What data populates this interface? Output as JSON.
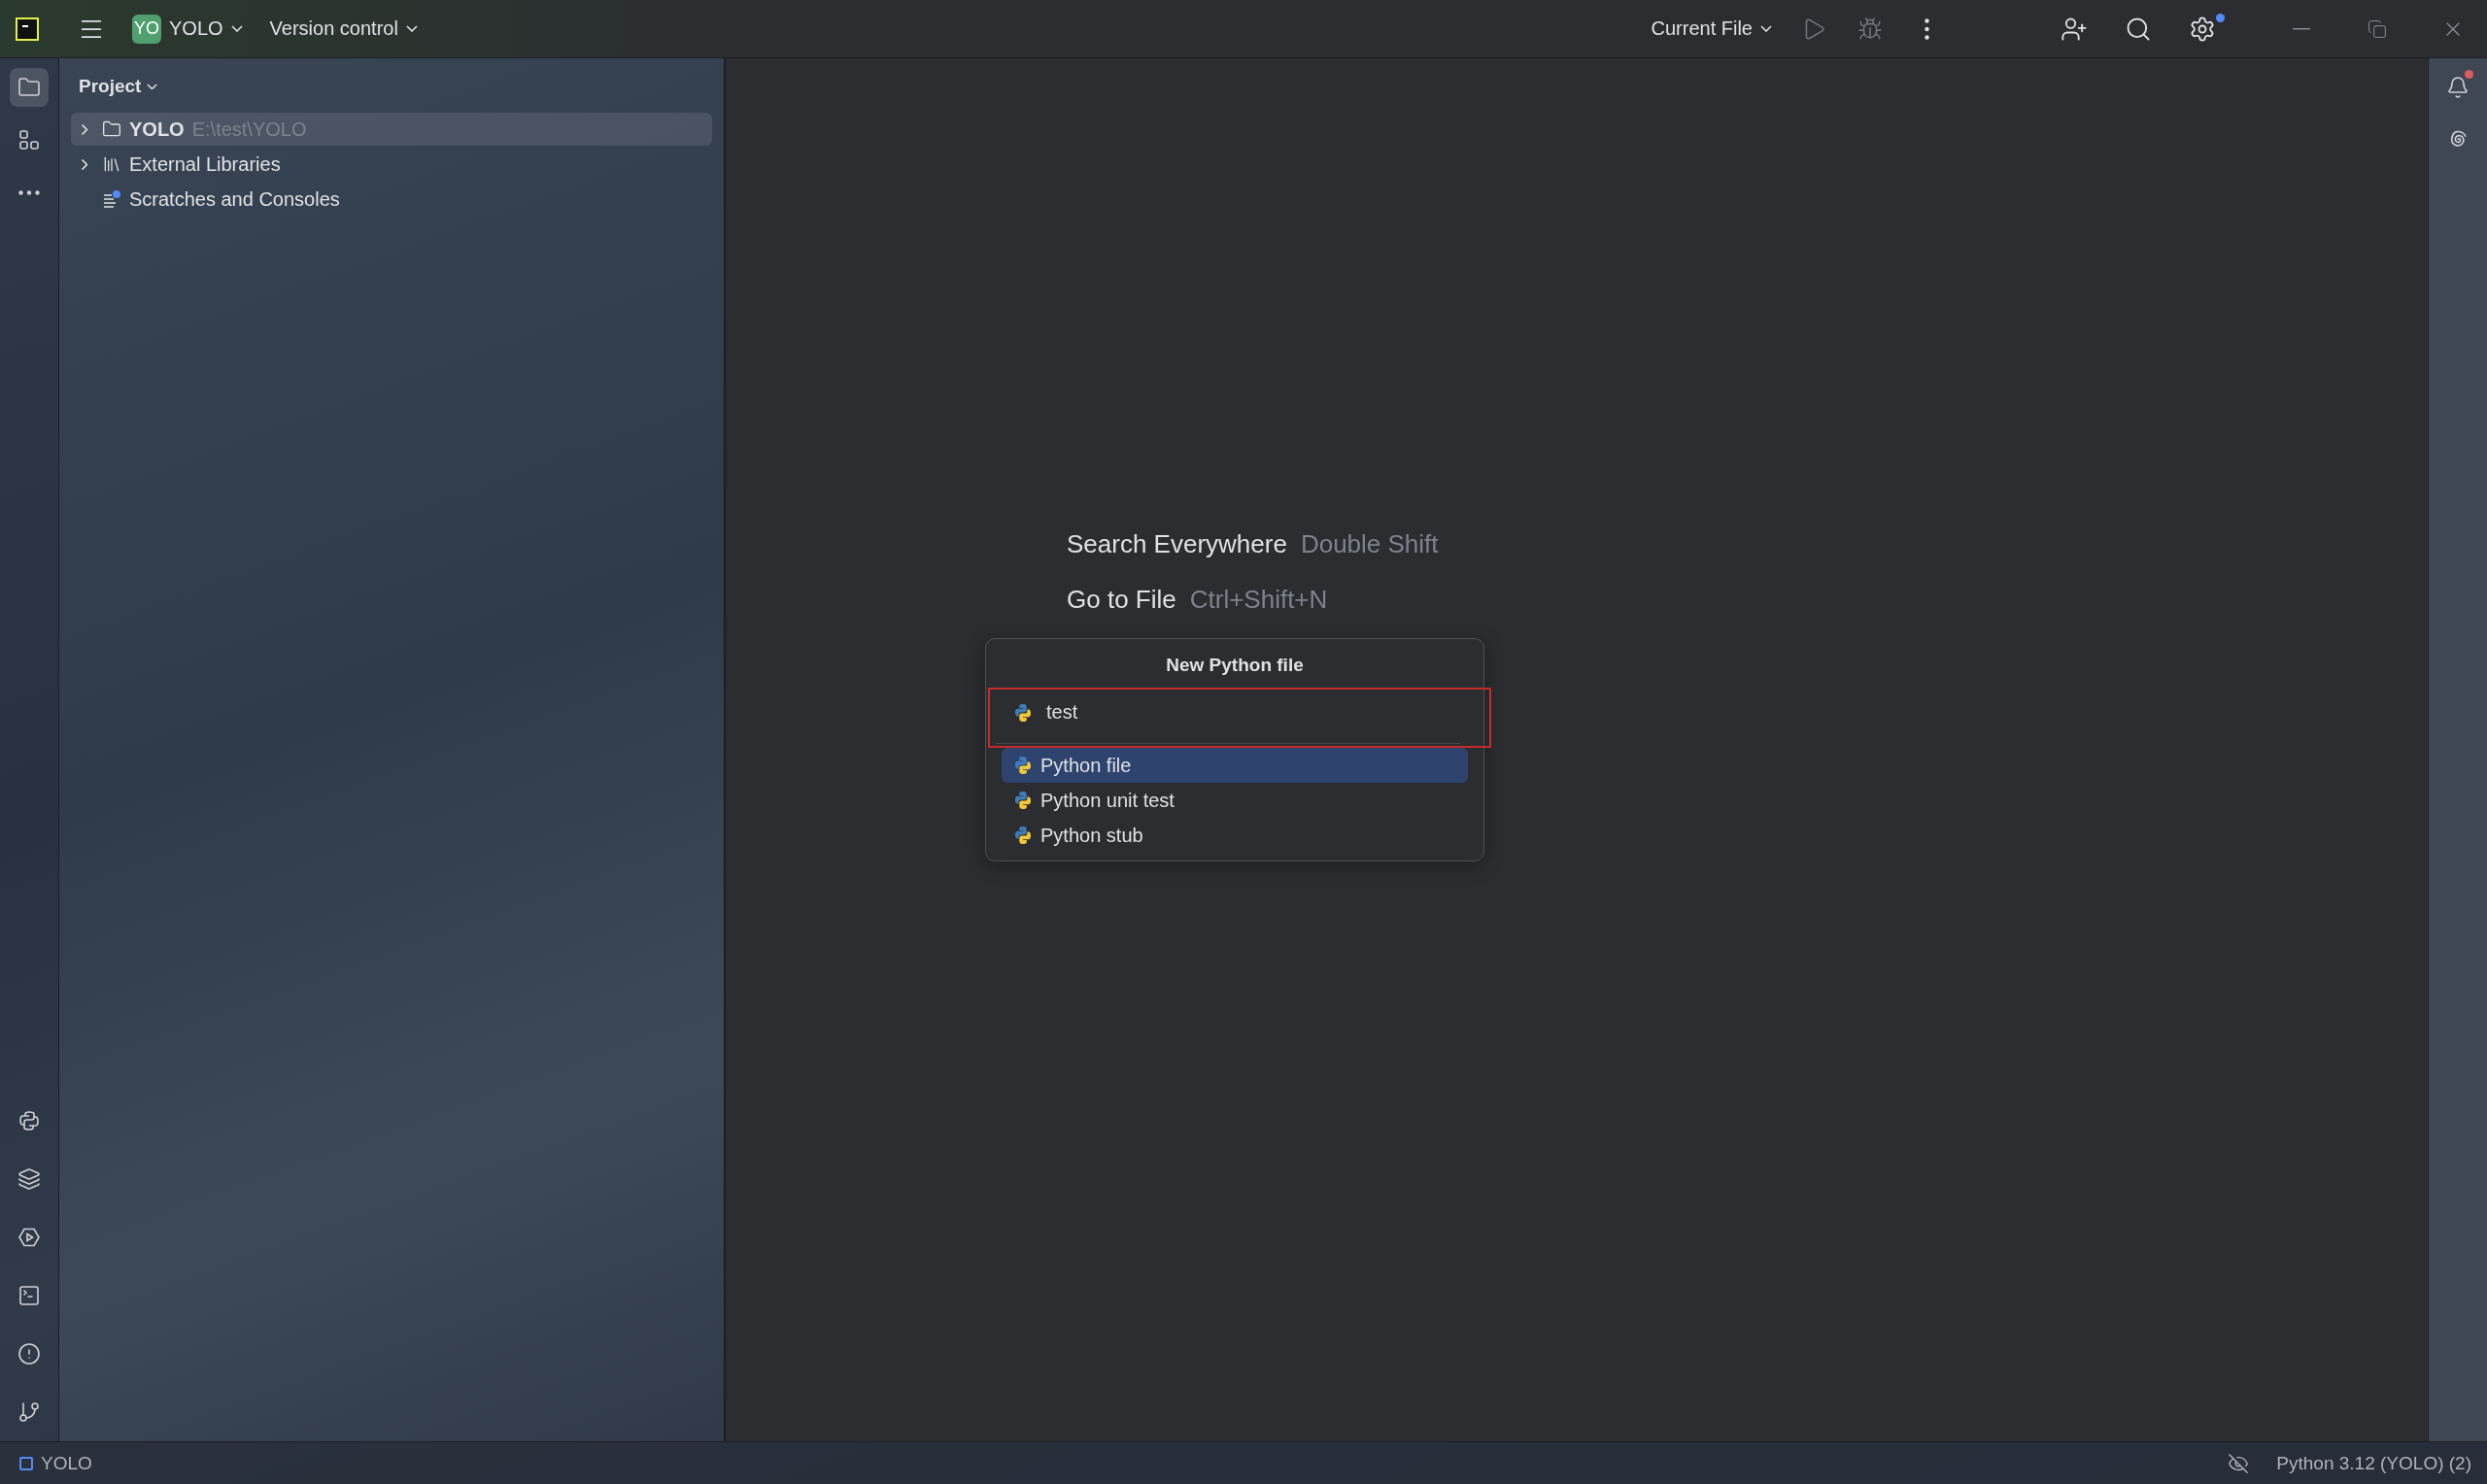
{
  "title_bar": {
    "project_badge": "YO",
    "project": "YOLO",
    "vcs": "Version control",
    "run_config": "Current File",
    "settings_update_dot": true
  },
  "left_toolbar": {
    "top": [
      {
        "kind": "project",
        "selected": true
      },
      {
        "kind": "structure",
        "selected": false
      },
      {
        "kind": "more",
        "selected": false
      }
    ],
    "bottom": [
      {
        "kind": "python",
        "selected": false
      },
      {
        "kind": "layers",
        "selected": false
      },
      {
        "kind": "services",
        "selected": false
      },
      {
        "kind": "terminal",
        "selected": false
      },
      {
        "kind": "problems",
        "selected": false
      },
      {
        "kind": "git",
        "selected": false
      }
    ]
  },
  "project_panel": {
    "title": "Project",
    "tree": [
      {
        "kind": "folder",
        "label": "YOLO",
        "path": "E:\\test\\YOLO",
        "expanded": false,
        "selected": true
      },
      {
        "kind": "library",
        "label": "External Libraries",
        "expanded": false,
        "selected": false
      },
      {
        "kind": "scratches",
        "label": "Scratches and Consoles",
        "selected": false
      }
    ]
  },
  "empty_state": [
    {
      "action": "Search Everywhere",
      "shortcut": "Double Shift"
    },
    {
      "action": "Go to File",
      "shortcut": "Ctrl+Shift+N"
    }
  ],
  "popup": {
    "title": "New Python file",
    "input": {
      "value": "test",
      "error": true
    },
    "items": [
      {
        "label": "Python file",
        "selected": true
      },
      {
        "label": "Python unit test",
        "selected": false
      },
      {
        "label": "Python stub",
        "selected": false
      }
    ]
  },
  "right_toolbar": {
    "notifications_unread": true
  },
  "status_bar": {
    "project": "YOLO",
    "interpreter": "Python 3.12 (YOLO) (2)"
  }
}
